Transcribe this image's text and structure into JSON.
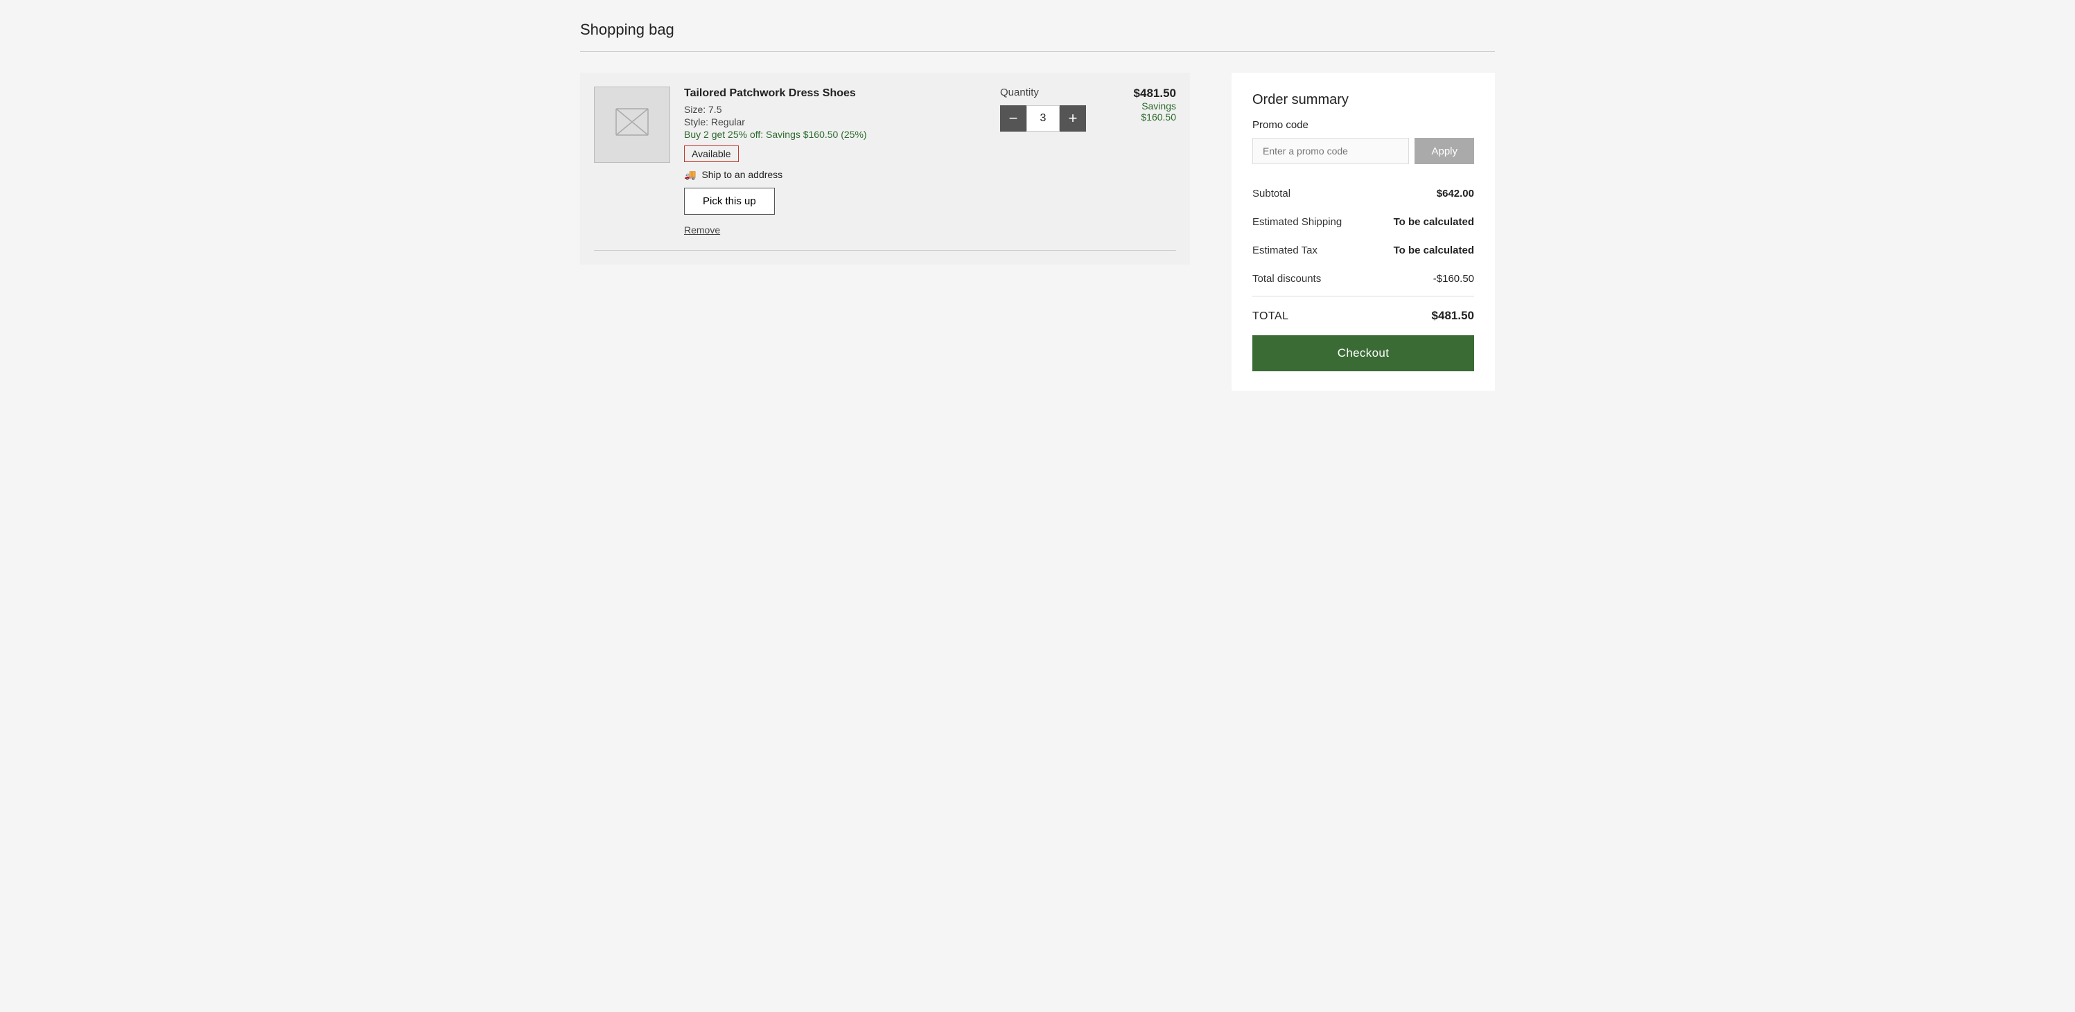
{
  "page": {
    "title": "Shopping bag"
  },
  "cart": {
    "item": {
      "name": "Tailored Patchwork Dress Shoes",
      "size": "Size: 7.5",
      "style": "Style: Regular",
      "promo_text": "Buy 2 get 25% off: Savings $160.50 (25%)",
      "availability": "Available",
      "ship_label": "Ship to an address",
      "pick_up_label": "Pick this up",
      "remove_label": "Remove",
      "quantity_label": "Quantity",
      "quantity": "3",
      "price": "$481.50",
      "savings_label": "Savings",
      "savings_amount": "$160.50"
    }
  },
  "order_summary": {
    "title": "Order summary",
    "promo_code_label": "Promo code",
    "promo_placeholder": "Enter a promo code",
    "apply_label": "Apply",
    "subtotal_label": "Subtotal",
    "subtotal_value": "$642.00",
    "shipping_label": "Estimated Shipping",
    "shipping_value": "To be calculated",
    "tax_label": "Estimated Tax",
    "tax_value": "To be calculated",
    "discounts_label": "Total discounts",
    "discounts_value": "-$160.50",
    "total_label": "TOTAL",
    "total_value": "$481.50",
    "checkout_label": "Checkout"
  },
  "colors": {
    "green_button": "#3a6b35",
    "savings_green": "#2d6a2d",
    "available_red_border": "#c0392b"
  }
}
